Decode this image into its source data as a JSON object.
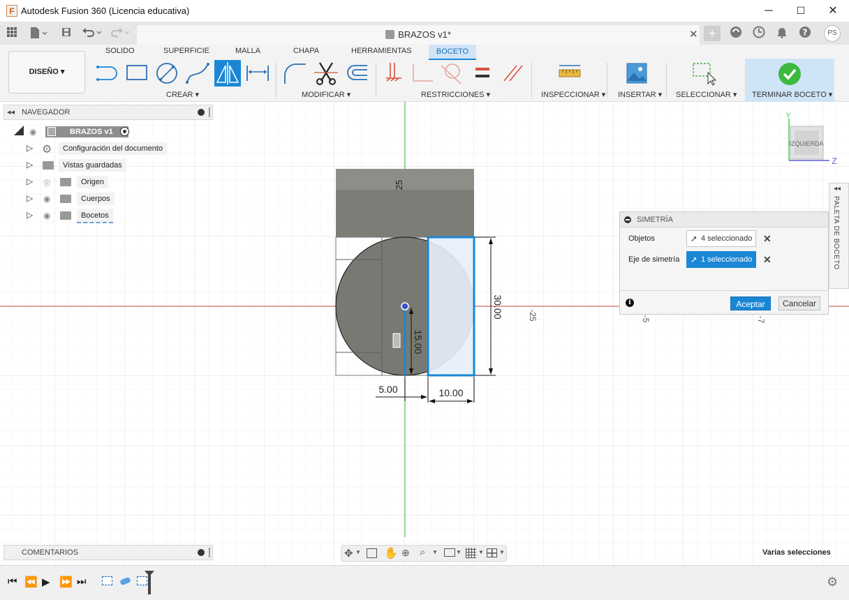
{
  "window": {
    "title": "Autodesk Fusion 360 (Licencia educativa)",
    "logo": "F",
    "minimize": "─",
    "maximize": "☐",
    "close": "✕"
  },
  "document": {
    "tab_title": "BRAZOS v1*",
    "close": "✕",
    "new_tab": "+"
  },
  "ribbon": {
    "workspace": "DISEÑO ▾",
    "tabs": [
      "SOLIDO",
      "SUPERFICIE",
      "MALLA",
      "CHAPA",
      "HERRAMIENTAS"
    ],
    "active_tab": "BOCETO",
    "groups": {
      "crear": "CREAR ▾",
      "modificar": "MODIFICAR ▾",
      "restricciones": "RESTRICCIONES ▾",
      "inspeccionar": "INSPECCIONAR ▾",
      "insertar": "INSERTAR ▾",
      "seleccionar": "SELECCIONAR ▾",
      "terminar": "TERMINAR BOCETO ▾"
    }
  },
  "user": {
    "initials": "PS"
  },
  "navigator": {
    "title": "NAVEGADOR",
    "root": "BRAZOS v1",
    "items": [
      "Configuración del documento",
      "Vistas guardadas",
      "Origen",
      "Cuerpos",
      "Bocetos"
    ]
  },
  "comments": {
    "title": "COMENTARIOS"
  },
  "viewcube": {
    "face": "IZQUIERDA",
    "y": "Y",
    "z": "Z"
  },
  "palette": {
    "label": "PALETA DE BOCETO"
  },
  "dialog": {
    "title": "SIMETRÍA",
    "objects_label": "Objetos",
    "objects_value": "4 seleccionado",
    "axis_label": "Eje de simetría",
    "axis_value": "1 seleccionado",
    "ok": "Aceptar",
    "cancel": "Cancelar"
  },
  "sketch": {
    "dim_top": "25",
    "dim_height": "30.00",
    "dim_half": "15.00",
    "dim_left": "5.00",
    "dim_width": "10.00",
    "grid_m25": "-25",
    "grid_m5": "-5",
    "grid_m7": "-7"
  },
  "status": {
    "text": "Varias selecciones"
  },
  "colors": {
    "accent": "#1a87d6",
    "x_axis": "#d9533c",
    "y_axis": "#4ec94e",
    "body": "#7a7a74"
  }
}
